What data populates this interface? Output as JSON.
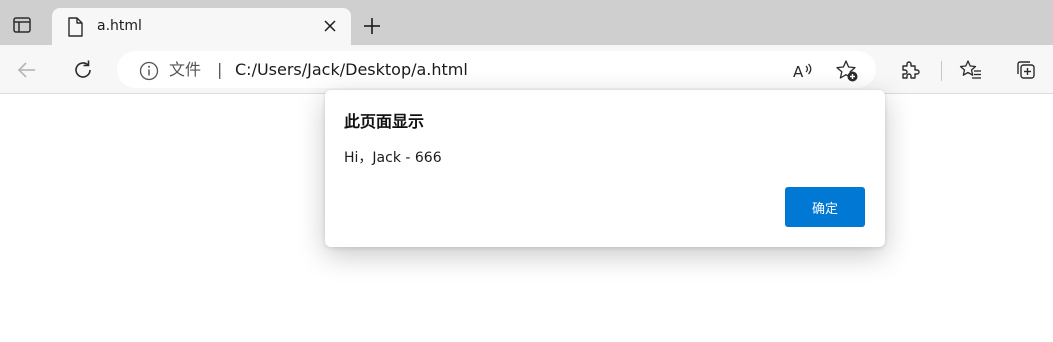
{
  "tab": {
    "title": "a.html",
    "favicon": "document-icon"
  },
  "toolbar": {
    "back_icon": "back-arrow-icon",
    "refresh_icon": "refresh-icon",
    "omnibox": {
      "scheme_label": "文件",
      "separator": "|",
      "url": "C:/Users/Jack/Desktop/a.html"
    }
  },
  "dialog": {
    "title": "此页面显示",
    "message": "Hi，Jack - 666",
    "ok_label": "确定"
  },
  "colors": {
    "tabstrip_bg": "#cfcfcf",
    "toolbar_bg": "#f7f7f7",
    "accent": "#0078d4"
  }
}
